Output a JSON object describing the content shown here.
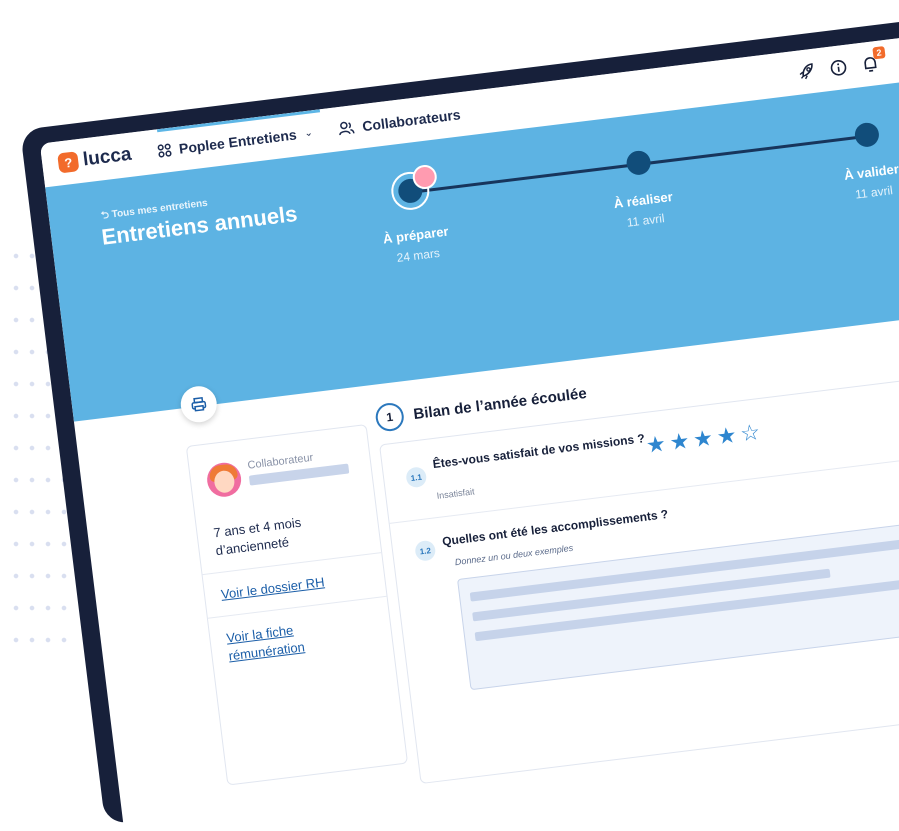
{
  "app": {
    "logo_text": "lucca",
    "logo_mark": "?"
  },
  "nav": [
    {
      "label": "Poplee Entretiens",
      "icon": "grid-icon",
      "dropdown": true
    },
    {
      "label": "Collaborateurs",
      "icon": "people-icon"
    }
  ],
  "topbar": {
    "icons": [
      "rocket-icon",
      "info-icon",
      "bell-icon"
    ],
    "notification_count": "2"
  },
  "hero": {
    "back_link": "⮌ Tous mes entretiens",
    "title": "Entretiens annuels",
    "steps": [
      {
        "name": "À préparer",
        "date": "24 mars",
        "current": true
      },
      {
        "name": "À réaliser",
        "date": "11 avril"
      },
      {
        "name": "À valider",
        "date": "11 avril"
      }
    ]
  },
  "collaborator": {
    "label": "Collaborateur",
    "tenure": "7 ans et 4 mois d’ancienneté",
    "links": [
      "Voir le dossier RH",
      "Voir la fiche rémunération"
    ]
  },
  "section": {
    "number": "1",
    "title": "Bilan de l’année écoulée",
    "questions": [
      {
        "num": "1.1",
        "text": "Êtes-vous satisfait de vos missions ?",
        "rating": 4,
        "rating_max": 5,
        "min_label": "Insatisfait"
      },
      {
        "num": "1.2",
        "text": "Quelles ont été les accomplissements ?",
        "hint": "Donnez un ou deux exemples"
      }
    ]
  },
  "colors": {
    "brand": "#f26b2b",
    "hero": "#5db3e3",
    "frame": "#17203a",
    "accent": "#2e86cf"
  }
}
